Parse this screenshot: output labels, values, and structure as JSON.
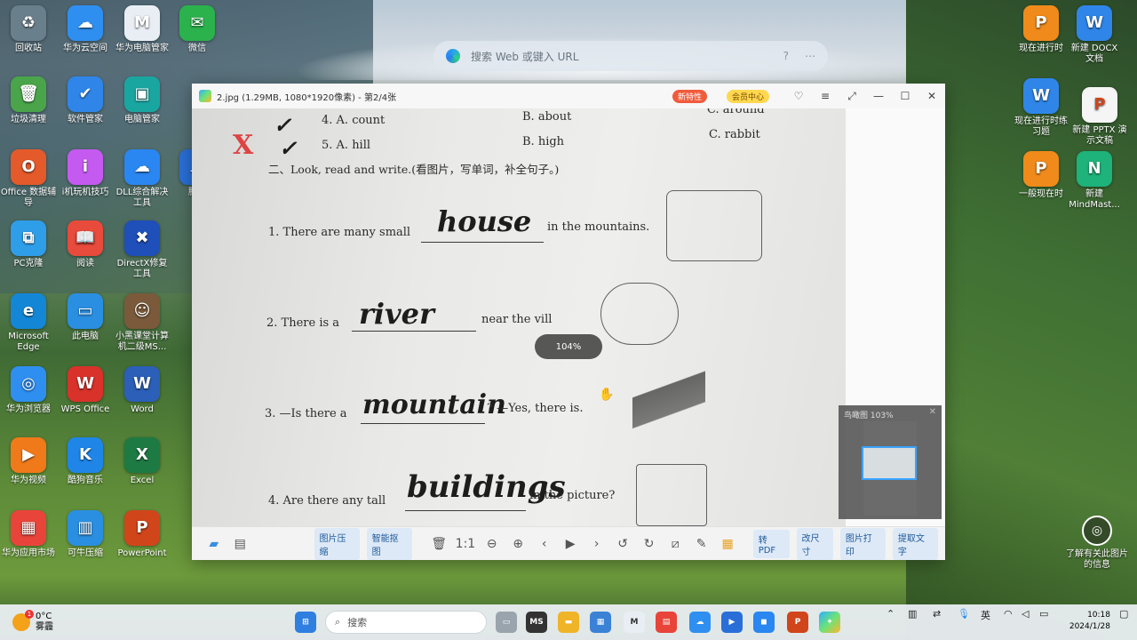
{
  "desktop": {
    "search_placeholder": "搜索 Web 或键入 URL",
    "left_icons": [
      {
        "label": "回收站",
        "color": "#6a7f8c",
        "glyph": "♻"
      },
      {
        "label": "华为云空间",
        "color": "#2f8ff0",
        "glyph": "☁"
      },
      {
        "label": "华为电脑管家",
        "color": "#e9eef5",
        "glyph": "M"
      },
      {
        "label": "微信",
        "color": "#2bb24c",
        "glyph": "✉"
      },
      {
        "label": "垃圾清理",
        "color": "#4aa54a",
        "glyph": "🗑"
      },
      {
        "label": "软件管家",
        "color": "#2f86e8",
        "glyph": "✔"
      },
      {
        "label": "电脑管家",
        "color": "#1aa6a0",
        "glyph": "▣"
      },
      {
        "label": "Office 数据辅导",
        "color": "#e45a2a",
        "glyph": "O"
      },
      {
        "label": "i机玩机技巧",
        "color": "#c55af0",
        "glyph": "i"
      },
      {
        "label": "DLL综合解决工具",
        "color": "#2a86f0",
        "glyph": "☁"
      },
      {
        "label": "腾讯",
        "color": "#2a6fd8",
        "glyph": "☁"
      },
      {
        "label": "PC克隆",
        "color": "#2f9ee8",
        "glyph": "⧉"
      },
      {
        "label": "阅读",
        "color": "#e84a3c",
        "glyph": "📖"
      },
      {
        "label": "DirectX修复工具",
        "color": "#1f4fb8",
        "glyph": "✖"
      },
      {
        "label": "Microsoft Edge",
        "color": "#1387d6",
        "glyph": "e"
      },
      {
        "label": "此电脑",
        "color": "#2a8fe0",
        "glyph": "▭"
      },
      {
        "label": "小黑课堂计算机二级MS...",
        "color": "#7a5a3a",
        "glyph": "☺"
      },
      {
        "label": "华为浏览器",
        "color": "#2f8ff0",
        "glyph": "◎"
      },
      {
        "label": "WPS Office",
        "color": "#d8322a",
        "glyph": "W"
      },
      {
        "label": "Word",
        "color": "#2b5fb8",
        "glyph": "W"
      },
      {
        "label": "华为视频",
        "color": "#f07a1a",
        "glyph": "▶"
      },
      {
        "label": "酷狗音乐",
        "color": "#1f86e8",
        "glyph": "K"
      },
      {
        "label": "Excel",
        "color": "#1e7a43",
        "glyph": "X"
      },
      {
        "label": "华为应用市场",
        "color": "#e8443a",
        "glyph": "▦"
      },
      {
        "label": "可牛压缩",
        "color": "#2a8fe0",
        "glyph": "▥"
      },
      {
        "label": "PowerPoint",
        "color": "#d1451b",
        "glyph": "P"
      }
    ],
    "right_icons": [
      {
        "label": "现在进行时",
        "color": "#f08a1a",
        "glyph": "P"
      },
      {
        "label": "新建 DOCX 文档",
        "color": "#2f86e8",
        "glyph": "W"
      },
      {
        "label": "现在进行时练习题",
        "color": "#2f86e8",
        "glyph": "W"
      },
      {
        "label": "新建 PPTX 演示文稿",
        "color": "#f5f5f5",
        "glyph": "P"
      },
      {
        "label": "一般现在时",
        "color": "#f08a1a",
        "glyph": "P"
      },
      {
        "label": "新建 MindMast...",
        "color": "#1db37a",
        "glyph": "N"
      }
    ],
    "info_text": "了解有关此图片的信息"
  },
  "viewer": {
    "title": "2.jpg (1.29MB, 1080*1920像素) - 第2/4张",
    "badge_new": "新特性",
    "badge_vip": "会员中心",
    "zoom": "104%",
    "navigator_title": "鸟瞰图 103%",
    "toolbar_buttons": [
      "图片压缩",
      "智能抠图",
      "转PDF",
      "改尺寸",
      "图片打印",
      "提取文字"
    ],
    "worksheet": {
      "line_a": "4. A. count",
      "line_a_b": "B. about",
      "line_a_c": "C. around",
      "line_b": "5. A. hill",
      "line_b_b": "B. high",
      "line_b_c": "C. rabbit",
      "section": "二、Look, read and write.(看图片，写单词，补全句子。)",
      "q1_pre": "1. There are many small",
      "q1_ans": "house",
      "q1_post": "in the mountains.",
      "q2_pre": "2. There is a",
      "q2_ans": "river",
      "q2_post": "near the vill",
      "q3_pre": "3. —Is there a",
      "q3_ans": "mountain",
      "q3_post": "? —Yes, there is.",
      "q4_pre": "4. Are there any tall",
      "q4_ans": "buildings",
      "q4_post": "in the picture?"
    }
  },
  "taskbar": {
    "temp": "0°C",
    "weather": "雾霾",
    "search": "搜索",
    "ime": "英",
    "time": "10:18",
    "date": "2024/1/28"
  }
}
